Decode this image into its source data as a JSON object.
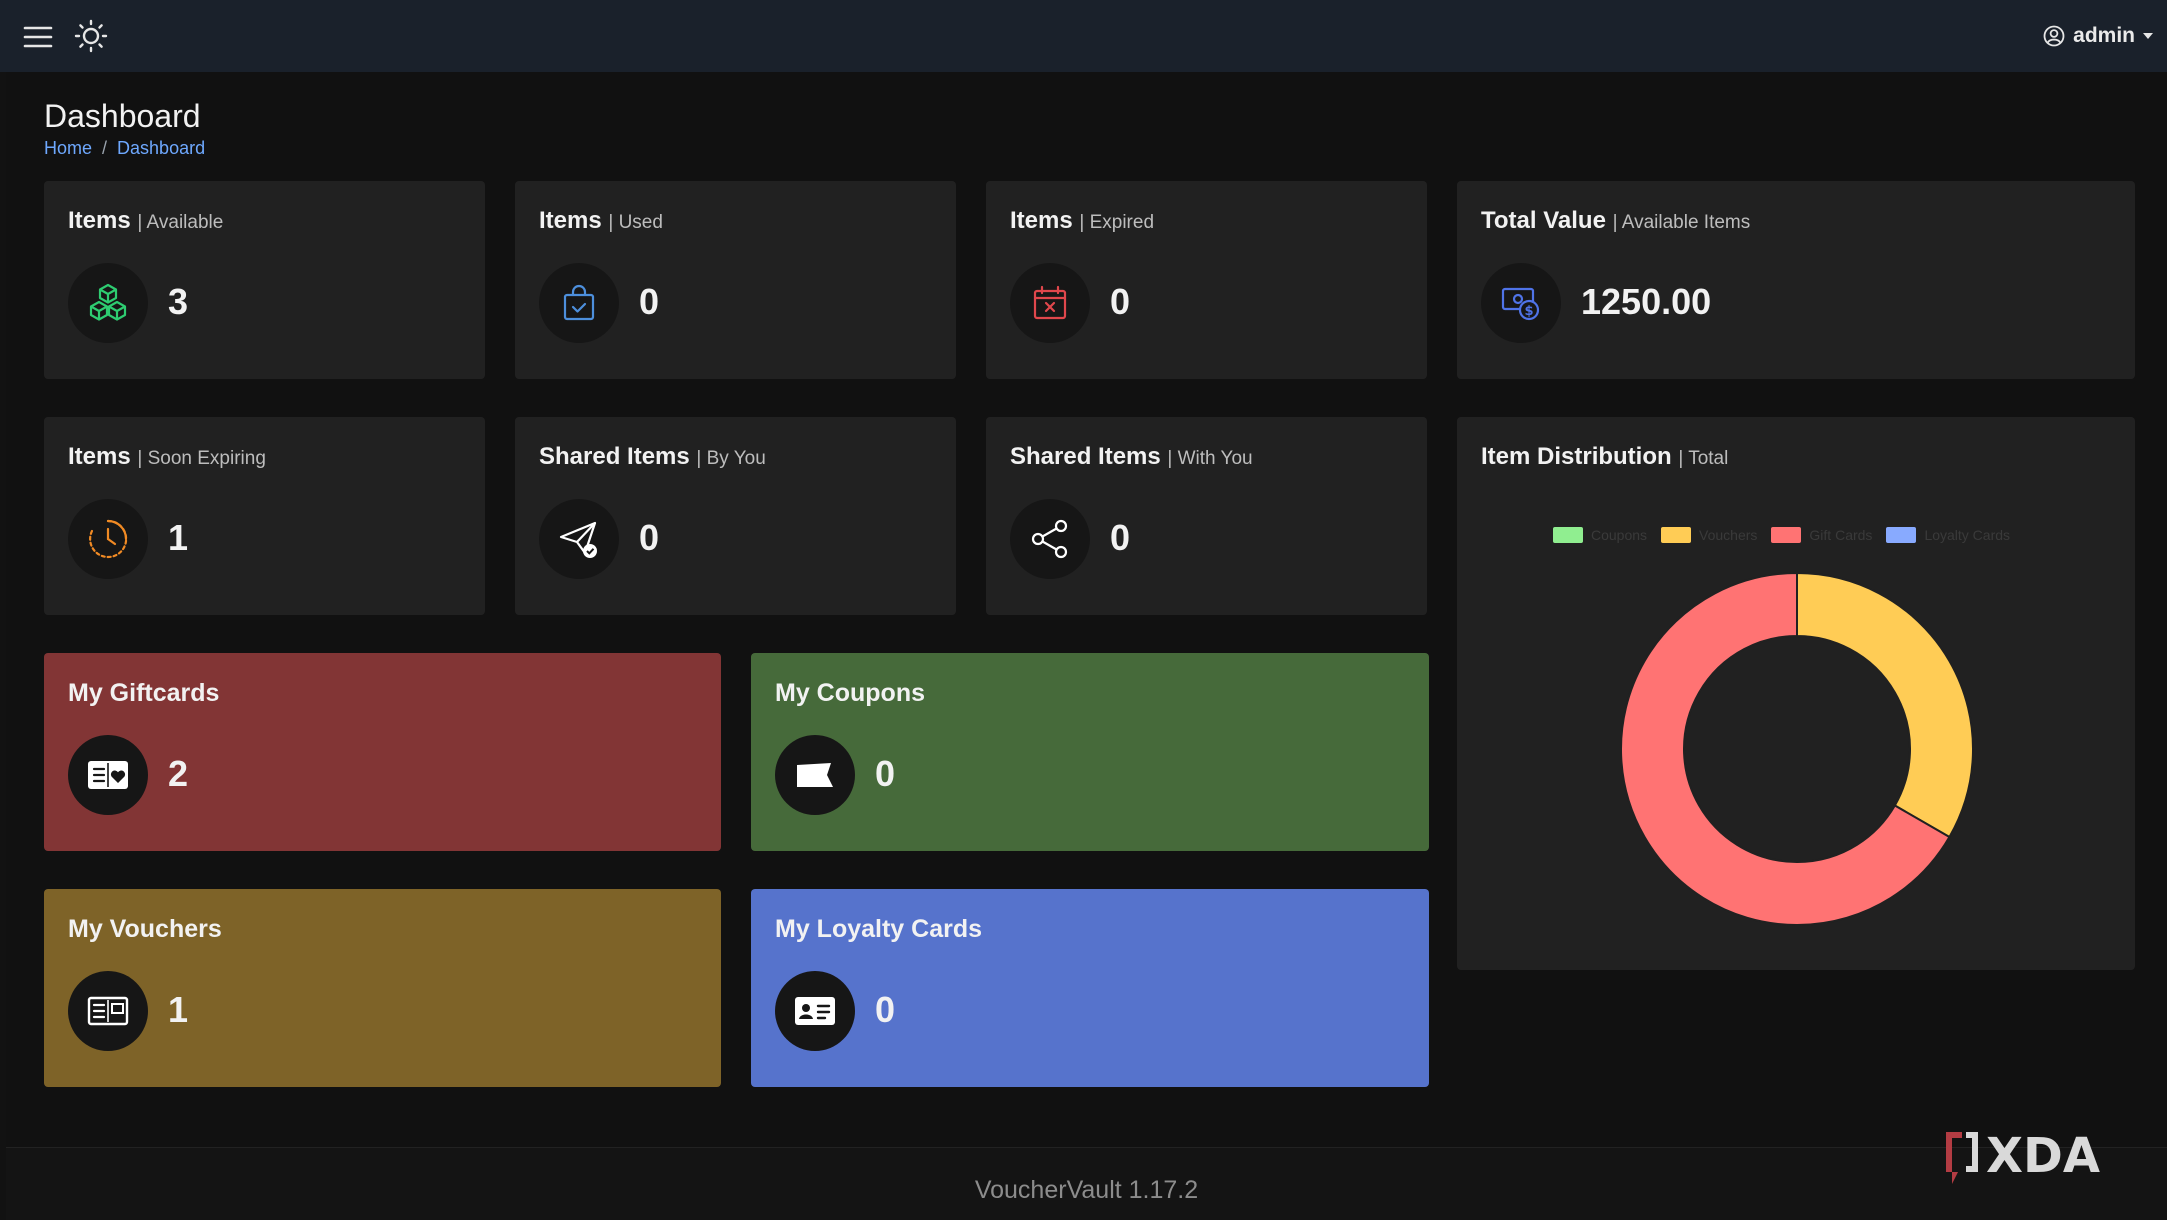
{
  "header": {
    "user_name": "admin",
    "icons": [
      "hamburger-menu-icon",
      "sun-icon",
      "user-circle-icon",
      "caret-down-icon"
    ]
  },
  "page": {
    "title": "Dashboard",
    "breadcrumb": [
      "Home",
      "Dashboard"
    ]
  },
  "stats": [
    {
      "title": "Items",
      "sub": "| Available",
      "value": "3",
      "icon": "boxes-icon",
      "icon_color": "#2ecc71"
    },
    {
      "title": "Items",
      "sub": "| Used",
      "value": "0",
      "icon": "shopping-bag-check-icon",
      "icon_color": "#4d8fdc"
    },
    {
      "title": "Items",
      "sub": "| Expired",
      "value": "0",
      "icon": "calendar-x-icon",
      "icon_color": "#e0474c"
    },
    {
      "title": "Total Value",
      "sub": "| Available Items",
      "value": "1250.00",
      "icon": "money-icon",
      "icon_color": "#4f73e8"
    },
    {
      "title": "Items",
      "sub": "| Soon Expiring",
      "value": "1",
      "icon": "clock-icon",
      "icon_color": "#f08a24"
    },
    {
      "title": "Shared Items",
      "sub": "| By You",
      "value": "0",
      "icon": "send-check-icon",
      "icon_color": "#ffffff"
    },
    {
      "title": "Shared Items",
      "sub": "| With You",
      "value": "0",
      "icon": "share-icon",
      "icon_color": "#ffffff"
    }
  ],
  "categories": [
    {
      "title": "My Giftcards",
      "value": "2",
      "bg": "#823535",
      "icon": "gift-card-icon"
    },
    {
      "title": "My Coupons",
      "value": "0",
      "bg": "#466a3a",
      "icon": "ticket-icon"
    },
    {
      "title": "My Vouchers",
      "value": "1",
      "bg": "#7e6328",
      "icon": "voucher-icon"
    },
    {
      "title": "My Loyalty Cards",
      "value": "0",
      "bg": "#5673cc",
      "icon": "id-card-icon"
    }
  ],
  "distribution": {
    "title": "Item Distribution",
    "sub": "| Total"
  },
  "chart_data": {
    "type": "pie",
    "donut": true,
    "categories": [
      "Coupons",
      "Vouchers",
      "Gift Cards",
      "Loyalty Cards"
    ],
    "values": [
      0,
      1,
      2,
      0
    ],
    "colors": [
      "#90ee90",
      "#ffcc55",
      "#ff7373",
      "#88aaff"
    ],
    "legend": "top"
  },
  "footer": {
    "version": "VoucherVault 1.17.2"
  },
  "watermark": "XDA"
}
